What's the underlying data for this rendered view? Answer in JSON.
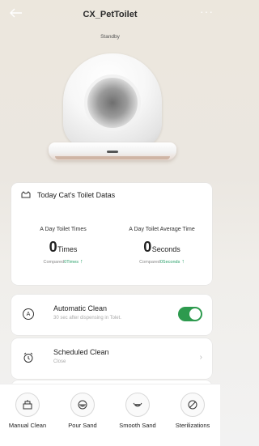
{
  "header": {
    "title": "CX_PetToilet",
    "status": "Standby",
    "back_icon": "arrow-left-icon",
    "more_icon": "more-horizontal-icon"
  },
  "stats": {
    "heading": "Today Cat's Toilet Datas",
    "left": {
      "label": "A Day Toilet Times",
      "value": "0",
      "unit": "Times",
      "compare_prefix": "Compared",
      "compare_value": "0",
      "compare_unit": "Times"
    },
    "right": {
      "label": "A Day Toilet Average Time",
      "value": "0",
      "unit": "Seconds",
      "compare_prefix": "Compared",
      "compare_value": "0",
      "compare_unit": "Seconds"
    }
  },
  "settings": {
    "auto_clean": {
      "title": "Automatic Clean",
      "subtitle": "30 sec after dispensing in Tolet.",
      "enabled": true
    },
    "scheduled_clean": {
      "title": "Scheduled Clean",
      "subtitle": "Close"
    }
  },
  "actions": [
    {
      "label": "Manual Clean",
      "icon": "manual-clean-icon"
    },
    {
      "label": "Pour Sand",
      "icon": "pour-sand-icon"
    },
    {
      "label": "Smooth Sand",
      "icon": "smooth-sand-icon"
    },
    {
      "label": "Sterilizations",
      "icon": "sterilization-icon"
    }
  ],
  "colors": {
    "accent": "#2d9a4e",
    "compare_text": "#2aa06a"
  }
}
